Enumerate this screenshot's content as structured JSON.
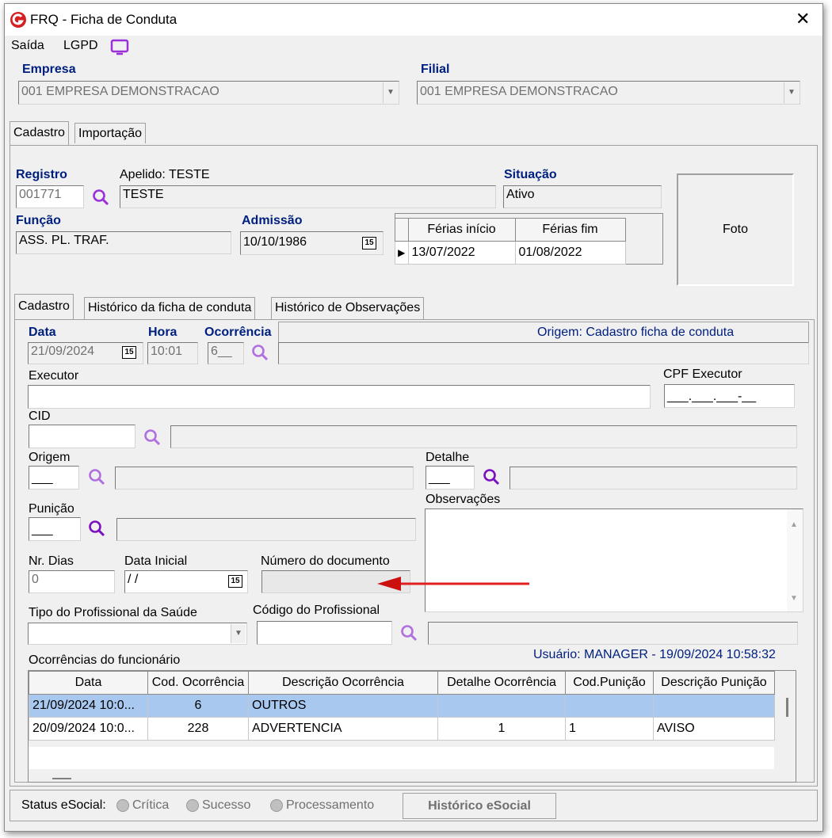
{
  "window": {
    "title": "FRQ - Ficha de Conduta",
    "close": "✕"
  },
  "menu": {
    "saida": "Saída",
    "lgpd": "LGPD"
  },
  "empresa": {
    "label": "Empresa",
    "value": "001 EMPRESA DEMONSTRACAO"
  },
  "filial": {
    "label": "Filial",
    "value": "001 EMPRESA DEMONSTRACAO"
  },
  "top_tabs": {
    "cadastro": "Cadastro",
    "importacao": "Importação"
  },
  "registro": {
    "label": "Registro",
    "value": "001771",
    "apelido_label": "Apelido: TESTE",
    "name": "TESTE"
  },
  "situacao": {
    "label": "Situação",
    "value": "Ativo"
  },
  "funcao": {
    "label": "Função",
    "value": "ASS. PL. TRAF."
  },
  "admissao": {
    "label": "Admissão",
    "value": "10/10/1986"
  },
  "ferias": {
    "col_inicio": "Férias início",
    "col_fim": "Férias fim",
    "inicio": "13/07/2022",
    "fim": "01/08/2022"
  },
  "foto": {
    "label": "Foto"
  },
  "inner_tabs": {
    "cadastro": "Cadastro",
    "historico": "Histórico da ficha de conduta",
    "observacoes": "Histórico de Observações"
  },
  "form": {
    "data_label": "Data",
    "data_value": "21/09/2024",
    "hora_label": "Hora",
    "hora_value": "10:01",
    "ocorrencia_label": "Ocorrência",
    "ocorrencia_value": "6__",
    "origem_text": "Origem: Cadastro ficha de conduta",
    "executor_label": "Executor",
    "cpf_label": "CPF Executor",
    "cpf_value": "___.___.___-__",
    "cid_label": "CID",
    "origem_label": "Origem",
    "origem_value": "___",
    "detalhe_label": "Detalhe",
    "detalhe_value": "___",
    "punicao_label": "Punição",
    "punicao_value": "___",
    "observacoes_label": "Observações",
    "nr_dias_label": "Nr. Dias",
    "nr_dias_value": "0",
    "data_inicial_label": "Data Inicial",
    "data_inicial_value": " / /",
    "numero_doc_label": "Número do documento",
    "tipo_prof_label": "Tipo do Profissional da Saúde",
    "codigo_prof_label": "Código do Profissional"
  },
  "ocorrencias": {
    "label": "Ocorrências do funcionário",
    "usuario": "Usuário: MANAGER - 19/09/2024 10:58:32",
    "columns": [
      "Data",
      "Cod. Ocorrência",
      "Descrição Ocorrência",
      "Detalhe Ocorrência",
      "Cod.Punição",
      "Descrição Punição"
    ],
    "rows": [
      [
        "21/09/2024 10:0...",
        "6",
        "OUTROS",
        "",
        "",
        ""
      ],
      [
        "20/09/2024 10:0...",
        "228",
        "ADVERTENCIA",
        "1",
        "1",
        "AVISO"
      ]
    ]
  },
  "status": {
    "label": "Status eSocial:",
    "critica": "Crítica",
    "sucesso": "Sucesso",
    "processamento": "Processamento",
    "historico_btn": "Histórico eSocial"
  },
  "calendar_icon_text": "15",
  "colors": {
    "accent_blue": "#00207f",
    "magnifier": "#9b30d9",
    "selected_row": "#a8c8f0",
    "arrow": "#e02020"
  }
}
